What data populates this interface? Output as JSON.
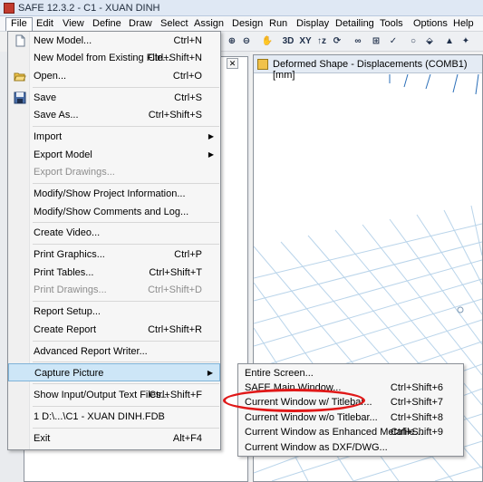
{
  "window": {
    "title": "SAFE 12.3.2 - C1 - XUAN DINH"
  },
  "menubar": {
    "items": [
      "File",
      "Edit",
      "View",
      "Define",
      "Draw",
      "Select",
      "Assign",
      "Design",
      "Run",
      "Display",
      "Detailing",
      "Tools",
      "Options",
      "Help"
    ],
    "active": "File"
  },
  "toolbar": {
    "icons": [
      "zoom-in",
      "zoom-out",
      "pan",
      "3d-view",
      "xy-view",
      "xz-view",
      "rotate-view",
      "glasses",
      "shrink",
      "check",
      "circle",
      "fill",
      "pointer",
      "mesh"
    ]
  },
  "view": {
    "title": "Deformed Shape - Displacements (COMB1)  [mm]"
  },
  "left_panel": {
    "close_glyph": "✕"
  },
  "file_menu": {
    "items": [
      {
        "label": "New Model...",
        "shortcut": "Ctrl+N",
        "icon": "new-file-icon"
      },
      {
        "label": "New Model from Existing File...",
        "shortcut": "Ctrl+Shift+N"
      },
      {
        "label": "Open...",
        "shortcut": "Ctrl+O",
        "icon": "open-folder-icon"
      },
      {
        "label": "Save",
        "shortcut": "Ctrl+S",
        "icon": "save-icon"
      },
      {
        "label": "Save As...",
        "shortcut": "Ctrl+Shift+S"
      },
      {
        "label": "Import",
        "submenu": true
      },
      {
        "label": "Export Model",
        "submenu": true
      },
      {
        "label": "Export Drawings...",
        "disabled": true
      },
      {
        "label": "Modify/Show Project Information..."
      },
      {
        "label": "Modify/Show Comments and Log..."
      },
      {
        "label": "Create Video..."
      },
      {
        "label": "Print Graphics...",
        "shortcut": "Ctrl+P"
      },
      {
        "label": "Print Tables...",
        "shortcut": "Ctrl+Shift+T"
      },
      {
        "label": "Print Drawings...",
        "shortcut": "Ctrl+Shift+D",
        "disabled": true
      },
      {
        "label": "Report Setup..."
      },
      {
        "label": "Create Report",
        "shortcut": "Ctrl+Shift+R"
      },
      {
        "label": "Advanced Report Writer..."
      },
      {
        "label": "Capture Picture",
        "submenu": true,
        "highlighted": true
      },
      {
        "label": "Show Input/Output Text Files...",
        "shortcut": "Ctrl+Shift+F"
      },
      {
        "label": "1 D:\\...\\C1 - XUAN DINH.FDB"
      },
      {
        "label": "Exit",
        "shortcut": "Alt+F4"
      }
    ]
  },
  "capture_submenu": {
    "items": [
      {
        "label": "Entire Screen...",
        "shortcut": ""
      },
      {
        "label": "SAFE Main Window...",
        "shortcut": "Ctrl+Shift+6"
      },
      {
        "label": "Current Window w/ Titlebar...",
        "shortcut": "Ctrl+Shift+7",
        "circled": true
      },
      {
        "label": "Current Window w/o Titlebar...",
        "shortcut": "Ctrl+Shift+8"
      },
      {
        "label": "Current Window as Enhanced Metafile...",
        "shortcut": "Ctrl+Shift+9"
      },
      {
        "label": "Current Window as DXF/DWG...",
        "shortcut": ""
      }
    ]
  },
  "colors": {
    "highlight": "#cde6f7",
    "annotation_red": "#e01818",
    "grid_blue": "#b9d4ea"
  }
}
